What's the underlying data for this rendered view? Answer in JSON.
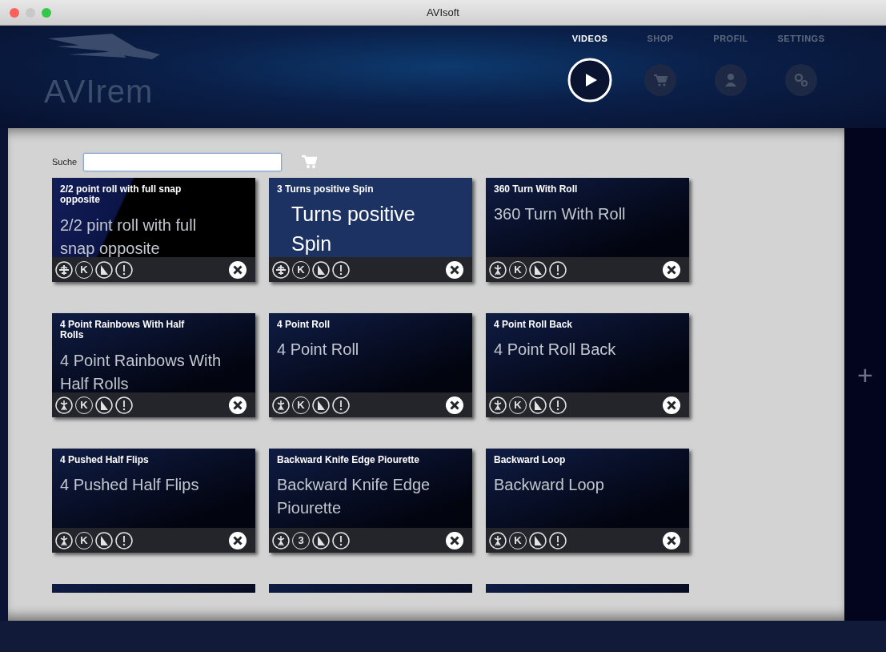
{
  "window": {
    "title": "AVIsoft"
  },
  "logo": {
    "text": "AVIrem"
  },
  "nav": [
    {
      "label": "VIDEOS",
      "selected": true,
      "kind": "play"
    },
    {
      "label": "SHOP",
      "selected": false,
      "kind": "cart"
    },
    {
      "label": "PROFIL",
      "selected": false,
      "kind": "person"
    },
    {
      "label": "SETTINGS",
      "selected": false,
      "kind": "gears"
    }
  ],
  "search": {
    "label": "Suche"
  },
  "cards": [
    {
      "title": "2/2 point roll with full snap opposite",
      "preview": "2/2 pint roll with full snap opposite",
      "selected": false,
      "kind": "plane",
      "grade": "K"
    },
    {
      "title": "3 Turns positive Spin",
      "preview": "Turns positive Spin",
      "selected": true,
      "kind": "plane",
      "grade": "K"
    },
    {
      "title": "360 Turn With Roll",
      "preview": "360 Turn With Roll",
      "selected": false,
      "kind": "figure",
      "grade": "K"
    },
    {
      "title": "4 Point Rainbows With Half Rolls",
      "preview": "4 Point Rainbows With Half Rolls",
      "selected": false,
      "kind": "figure",
      "grade": "K"
    },
    {
      "title": "4 Point Roll",
      "preview": "4 Point Roll",
      "selected": false,
      "kind": "figure",
      "grade": "K"
    },
    {
      "title": "4 Point Roll Back",
      "preview": "4 Point Roll Back",
      "selected": false,
      "kind": "figure",
      "grade": "K"
    },
    {
      "title": "4 Pushed Half Flips",
      "preview": "4 Pushed Half Flips",
      "selected": false,
      "kind": "figure",
      "grade": "K"
    },
    {
      "title": "Backward Knife Edge Piourette",
      "preview": "Backward Knife Edge Piourette",
      "selected": false,
      "kind": "figure",
      "grade": "3"
    },
    {
      "title": "Backward Loop",
      "preview": "Backward Loop",
      "selected": false,
      "kind": "figure",
      "grade": "K"
    }
  ],
  "cut_off_cards": [
    {
      "kind": "video"
    },
    {
      "kind": "video"
    },
    {
      "kind": "video"
    }
  ],
  "add_button": {
    "label": "+"
  }
}
